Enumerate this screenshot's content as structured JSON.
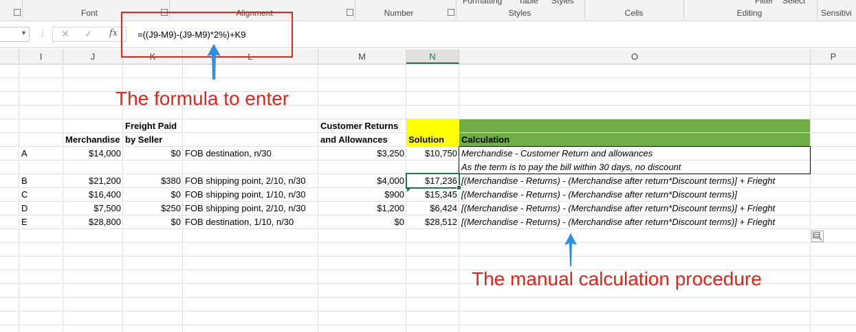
{
  "ribbon": {
    "groups": [
      {
        "label": "Font"
      },
      {
        "label": "Alignment"
      },
      {
        "label": "Number"
      },
      {
        "label": "Styles"
      },
      {
        "label": "Cells"
      },
      {
        "label": "Editing"
      },
      {
        "label": "Sensitivi"
      }
    ],
    "cutoff_top": [
      "Formatting",
      "Table",
      "Styles",
      "Filter",
      "Select"
    ]
  },
  "formula_bar": {
    "formula": "=((J9-M9)-(J9-M9)*2%)+K9",
    "fx_label": "fx"
  },
  "columns": [
    "I",
    "J",
    "K",
    "L",
    "M",
    "N",
    "O",
    "P"
  ],
  "selected_column": "N",
  "headers": {
    "merchandise": "Merchandise",
    "freight_line1": "Freight Paid",
    "freight_line2": "by Seller",
    "returns_line1": "Customer Returns",
    "returns_line2": "and Allowances",
    "solution": "Solution",
    "calculation": "Calculation"
  },
  "rows": [
    {
      "label": "A",
      "merchandise": "$14,000",
      "freight": "$0",
      "terms": "FOB destination, n/30",
      "returns": "$3,250",
      "solution": "$10,750",
      "calc": "Merchandise - Customer Return and allowances",
      "calc2": "As the term is to pay the bill within 30 days, no discount"
    },
    {
      "label": "B",
      "merchandise": "$21,200",
      "freight": "$380",
      "terms": "FOB shipping point, 2/10, n/30",
      "returns": "$4,000",
      "solution": "$17,236",
      "calc": "[(Merchandise - Returns) - (Merchandise after return*Discount terms)] + Frieght"
    },
    {
      "label": "C",
      "merchandise": "$16,400",
      "freight": "$0",
      "terms": "FOB shipping point, 1/10, n/30",
      "returns": "$900",
      "solution": "$15,345",
      "calc": "[(Merchandise - Returns) - (Merchandise after return*Discount terms)]"
    },
    {
      "label": "D",
      "merchandise": "$7,500",
      "freight": "$250",
      "terms": "FOB shipping point, 2/10, n/30",
      "returns": "$1,200",
      "solution": "$6,424",
      "calc": "[(Merchandise - Returns) - (Merchandise after return*Discount terms)] + Frieght"
    },
    {
      "label": "E",
      "merchandise": "$28,800",
      "freight": "$0",
      "terms": "FOB destination, 1/10, n/30",
      "returns": "$0",
      "solution": "$28,512",
      "calc": "[(Merchandise - Returns) - (Merchandise after return*Discount terms)] + Frieght"
    }
  ],
  "annotations": {
    "formula_note": "The formula to enter",
    "manual_note": "The manual calculation procedure"
  },
  "colors": {
    "annotation_red": "#e0251b",
    "arrow_blue": "#2e8fe6",
    "solution_header_fill": "#ffff00",
    "calculation_header_fill": "#70ad47",
    "excel_green": "#217346"
  }
}
